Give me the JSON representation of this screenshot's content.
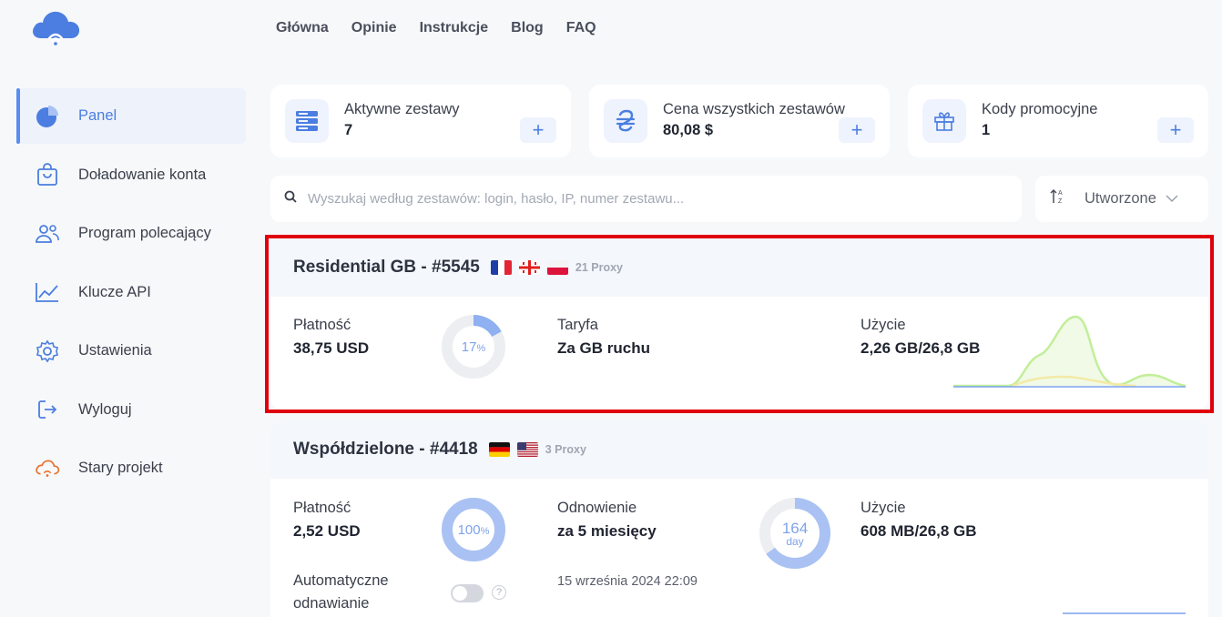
{
  "nav": [
    "Główna",
    "Opinie",
    "Instrukcje",
    "Blog",
    "FAQ"
  ],
  "sidebar": {
    "items": [
      {
        "label": "Panel",
        "icon": "pie-chart-icon",
        "active": true
      },
      {
        "label": "Doładowanie konta",
        "icon": "shopping-bag-icon"
      },
      {
        "label": "Program polecający",
        "icon": "users-icon"
      },
      {
        "label": "Klucze API",
        "icon": "line-chart-icon"
      },
      {
        "label": "Ustawienia",
        "icon": "gear-icon"
      },
      {
        "label": "Wyloguj",
        "icon": "logout-icon"
      },
      {
        "label": "Stary projekt",
        "icon": "cloud-icon"
      }
    ]
  },
  "stats": [
    {
      "label": "Aktywne zestawy",
      "value": "7",
      "icon": "server-icon"
    },
    {
      "label": "Cena wszystkich zestawów",
      "value": "80,08 $",
      "icon": "hryvnia-icon"
    },
    {
      "label": "Kody promocyjne",
      "value": "1",
      "icon": "gift-icon"
    }
  ],
  "search": {
    "placeholder": "Wyszukaj według zestawów: login, hasło, IP, numer zestawu..."
  },
  "sort": {
    "label": "Utworzone"
  },
  "orders": [
    {
      "title": "Residential GB - #5545",
      "flags": [
        "fr",
        "ge",
        "pl"
      ],
      "proxy_count": "21 Proxy",
      "payment_label": "Płatność",
      "payment_value": "38,75 USD",
      "percent_num": "17",
      "percent_unit": "%",
      "percent_fraction": 0.17,
      "tariff_label": "Taryfa",
      "tariff_value": "Za GB ruchu",
      "usage_label": "Użycie",
      "usage_value": "2,26 GB/26,8 GB"
    },
    {
      "title": "Współdzielone - #4418",
      "flags": [
        "de",
        "us"
      ],
      "proxy_count": "3 Proxy",
      "payment_label": "Płatność",
      "payment_value": "2,52 USD",
      "percent_num": "100",
      "percent_unit": "%",
      "percent_fraction": 1.0,
      "renew_label": "Odnowienie",
      "renew_value": "za 5 miesięcy",
      "days_num": "164",
      "days_unit": "day",
      "days_fraction": 0.65,
      "usage_label": "Użycie",
      "usage_value": "608 MB/26,8 GB",
      "auto_renew_line1": "Automatyczne",
      "auto_renew_line2": "odnawianie",
      "auto_renew_on": false,
      "date": "15 września 2024 22:09"
    }
  ],
  "colors": {
    "accent": "#4b7ee0",
    "accent_light": "#eef3fd",
    "highlight": "#e0000d"
  }
}
